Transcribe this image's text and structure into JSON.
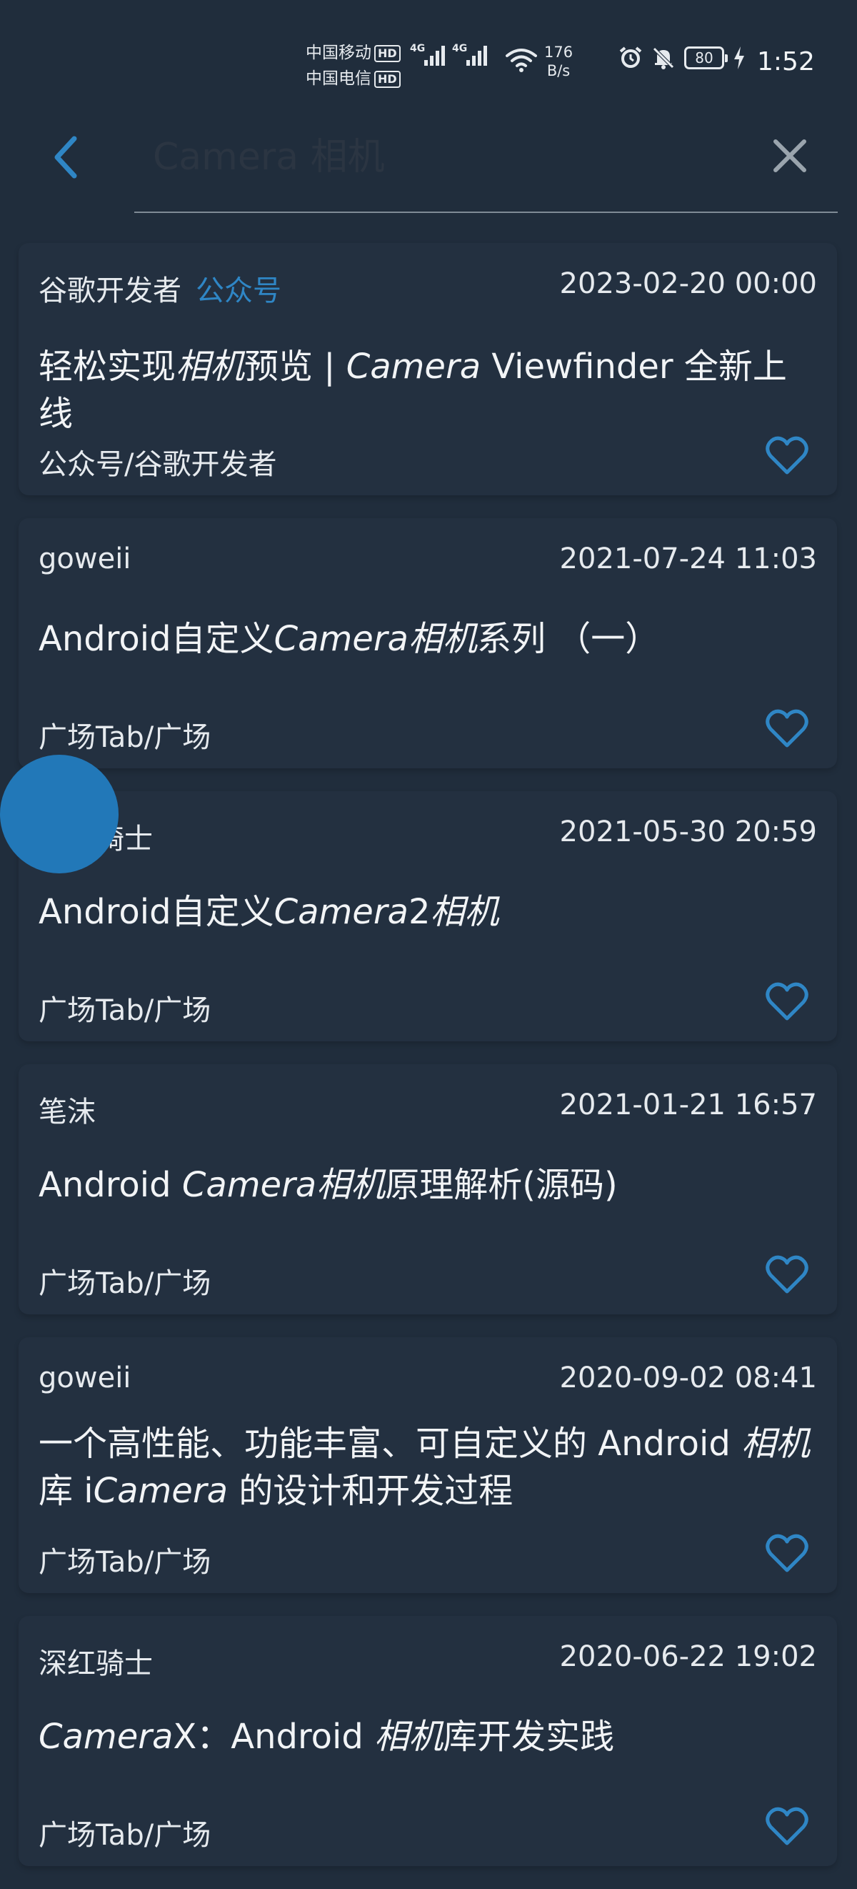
{
  "status_bar": {
    "carrier1": "中国移动",
    "carrier2": "中国电信",
    "hd": "HD",
    "net1": "4G",
    "net2": "4G",
    "speed_value": "176",
    "speed_unit": "B/s",
    "battery": "80",
    "time": "1:52"
  },
  "search": {
    "placeholder": "Camera 相机",
    "value": ""
  },
  "colors": {
    "background": "#202d3c",
    "card": "#233040",
    "accent": "#2f86c5",
    "fab": "#2278b8"
  },
  "articles": [
    {
      "author": "谷歌开发者",
      "tag": "公众号",
      "date": "2023-02-20 00:00",
      "title": {
        "a": "轻松实现",
        "b": "相机",
        "c": "预览 | ",
        "d": "Camera",
        "e": " Viewfinder 全新上线",
        "f": "",
        "g": ""
      },
      "chapter": "公众号/谷歌开发者"
    },
    {
      "author": "goweii",
      "tag": "",
      "date": "2021-07-24 11:03",
      "title": {
        "a": "Android自定义",
        "b": "Camera",
        "c": "",
        "d": "相机",
        "e": "系列 （一）",
        "f": "",
        "g": ""
      },
      "chapter": "广场Tab/广场"
    },
    {
      "author": "深红骑士",
      "tag": "",
      "date": "2021-05-30 20:59",
      "title": {
        "a": "Android自定义",
        "b": "Camera",
        "c": "2",
        "d": "相机",
        "e": "",
        "f": "",
        "g": ""
      },
      "chapter": "广场Tab/广场"
    },
    {
      "author": "笔沫",
      "tag": "",
      "date": "2021-01-21 16:57",
      "title": {
        "a": "Android ",
        "b": "Camera",
        "c": "",
        "d": "相机",
        "e": "原理解析(源码)",
        "f": "",
        "g": ""
      },
      "chapter": "广场Tab/广场"
    },
    {
      "author": "goweii",
      "tag": "",
      "date": "2020-09-02 08:41",
      "title": {
        "a": "一个高性能、功能丰富、可自定义的 Android ",
        "b": "相机",
        "c": "库 i",
        "d": "Camera",
        "e": " 的设计和开发过程",
        "f": "",
        "g": ""
      },
      "chapter": "广场Tab/广场"
    },
    {
      "author": "深红骑士",
      "tag": "",
      "date": "2020-06-22 19:02",
      "title": {
        "a": "",
        "b": "Camera",
        "c": "X：Android ",
        "d": "相机",
        "e": "库开发实践",
        "f": "",
        "g": ""
      },
      "chapter": "广场Tab/广场"
    }
  ]
}
